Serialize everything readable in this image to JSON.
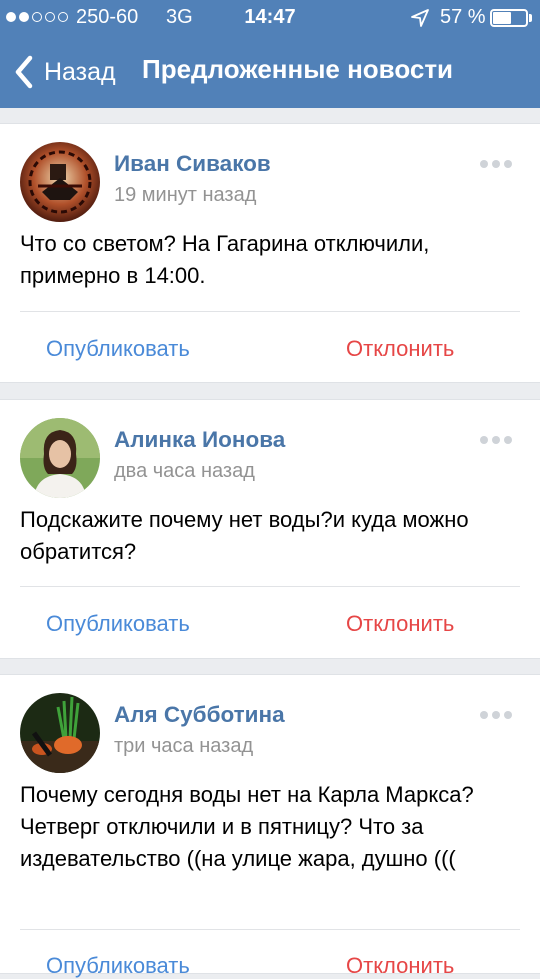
{
  "status_bar": {
    "carrier": "250-60",
    "network": "3G",
    "time": "14:47",
    "battery": "57 %",
    "battery_level": 0.57
  },
  "nav": {
    "back_label": "Назад",
    "title": "Предложенные новости"
  },
  "posts": [
    {
      "author": "Иван Сиваков",
      "time": "19 минут назад",
      "text": "Что со светом? На Гагарина отключили, примерно в 14:00.",
      "publish_label": "Опубликовать",
      "reject_label": "Отклонить"
    },
    {
      "author": "Алинка Ионова",
      "time": "два часа назад",
      "text": "Подскажите почему нет воды?и куда можно обратится?",
      "publish_label": "Опубликовать",
      "reject_label": "Отклонить"
    },
    {
      "author": "Аля Субботина",
      "time": "три часа назад",
      "text": "Почему сегодня воды нет на Карла Маркса? Четверг отключили и в пятницу? Что за издевательство ((на улице жара, душно  (((",
      "publish_label": "Опубликовать",
      "reject_label": "Отклонить"
    }
  ]
}
